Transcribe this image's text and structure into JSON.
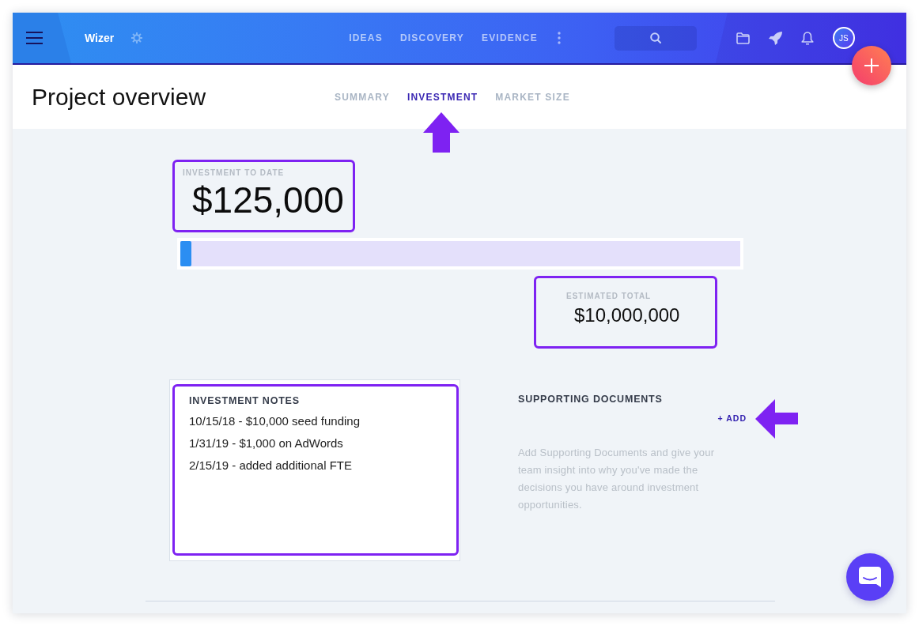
{
  "app": {
    "name": "Wizer"
  },
  "nav": [
    {
      "label": "IDEAS"
    },
    {
      "label": "DISCOVERY"
    },
    {
      "label": "EVIDENCE"
    }
  ],
  "user": {
    "initials": "JS"
  },
  "page": {
    "title": "Project overview"
  },
  "tabs": [
    {
      "label": "SUMMARY",
      "selected": false
    },
    {
      "label": "INVESTMENT",
      "selected": true
    },
    {
      "label": "MARKET SIZE",
      "selected": false
    }
  ],
  "investment_to_date": {
    "label": "INVESTMENT TO DATE",
    "value": "$125,000",
    "highlighted": true
  },
  "progress": {
    "level": 0.02
  },
  "estimated_total": {
    "label": "ESTIMATED TOTAL",
    "value": "$10,000,000",
    "highlighted": true
  },
  "notes": {
    "title": "INVESTMENT NOTES",
    "highlighted": true,
    "items": [
      "10/15/18 - $10,000 seed funding",
      "1/31/19 - $1,000 on AdWords",
      "2/15/19 - added additional FTE"
    ]
  },
  "supporting_documents": {
    "title": "SUPPORTING DOCUMENTS",
    "add_label": "+ ADD",
    "description": "Add Supporting Documents and give your team insight into why you've made the decisions you have around investment opportunities."
  }
}
